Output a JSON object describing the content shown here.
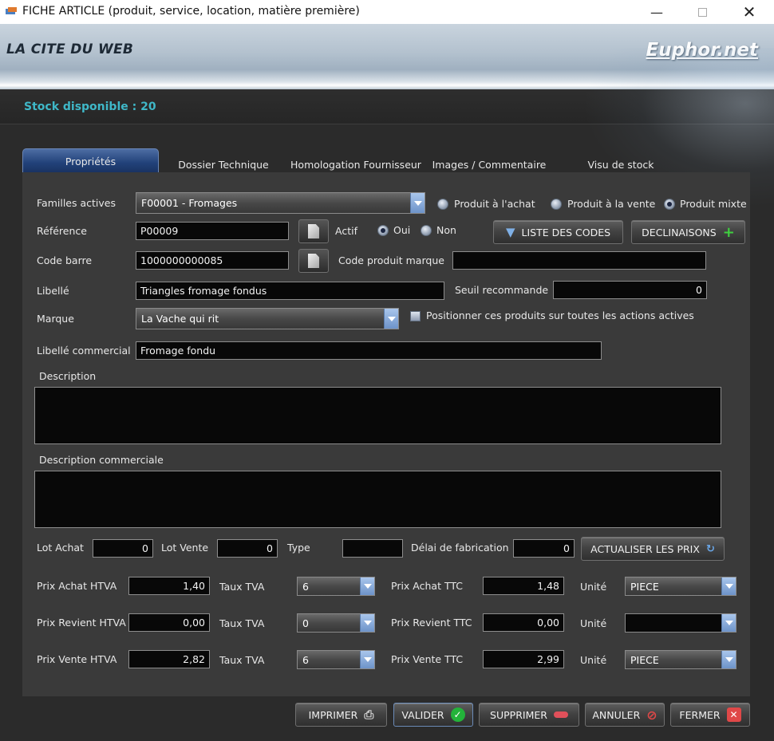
{
  "window": {
    "title": "FICHE ARTICLE (produit, service, location, matière première)"
  },
  "banner": {
    "company": "LA CITE DU WEB",
    "brand": "Euphor.net"
  },
  "stock": {
    "text": "Stock disponible : 20"
  },
  "tabs": [
    "Propriétés",
    "Dossier Technique",
    "Homologation Fournisseur",
    "Images / Commentaire",
    "Visu de stock"
  ],
  "form": {
    "familles_label": "Familles actives",
    "familles_value": "F00001 - Fromages",
    "type_options": [
      "Produit à l'achat",
      "Produit à la vente",
      "Produit mixte"
    ],
    "reference_label": "Référence",
    "reference_value": "P00009",
    "actif_label": "Actif",
    "actif_options": [
      "Oui",
      "Non"
    ],
    "liste_codes_button": "LISTE DES CODES",
    "declinaisons_button": "DECLINAISONS",
    "code_barre_label": "Code barre",
    "code_barre_value": "1000000000085",
    "code_produit_marque_label": "Code produit marque",
    "code_produit_marque_value": "",
    "libelle_label": "Libellé",
    "libelle_value": "Triangles fromage fondus",
    "seuil_label": "Seuil recommande",
    "seuil_value": "0",
    "marque_label": "Marque",
    "marque_value": "La Vache qui rit",
    "positionner_label": "Positionner ces produits sur toutes les actions actives",
    "libelle_commercial_label": "Libellé commercial",
    "libelle_commercial_value": "Fromage fondu",
    "description_label": "Description",
    "description_commerciale_label": "Description commerciale",
    "lot_achat_label": "Lot Achat",
    "lot_achat_value": "0",
    "lot_vente_label": "Lot Vente",
    "lot_vente_value": "0",
    "type_label": "Type",
    "type_value": "",
    "delai_label": "Délai de fabrication",
    "delai_value": "0",
    "actualiser_button": "ACTUALISER LES PRIX"
  },
  "prices": [
    {
      "htva_label": "Prix Achat HTVA",
      "htva_value": "1,40",
      "tva_label": "Taux TVA",
      "tva_value": "6",
      "ttc_label": "Prix Achat TTC",
      "ttc_value": "1,48",
      "unite_label": "Unité",
      "unite_value": "PIECE"
    },
    {
      "htva_label": "Prix Revient HTVA",
      "htva_value": "0,00",
      "tva_label": "Taux TVA",
      "tva_value": "0",
      "ttc_label": "Prix Revient TTC",
      "ttc_value": "0,00",
      "unite_label": "Unité",
      "unite_value": ""
    },
    {
      "htva_label": "Prix Vente HTVA",
      "htva_value": "2,82",
      "tva_label": "Taux TVA",
      "tva_value": "6",
      "ttc_label": "Prix Vente TTC",
      "ttc_value": "2,99",
      "unite_label": "Unité",
      "unite_value": "PIECE"
    }
  ],
  "footer": {
    "imprimer": "IMPRIMER",
    "valider": "VALIDER",
    "supprimer": "SUPPRIMER",
    "annuler": "ANNULER",
    "fermer": "FERMER"
  },
  "colors": {
    "accent": "#3fb8c8",
    "tab_active": "#22427a",
    "panel": "#3a3a3a"
  }
}
